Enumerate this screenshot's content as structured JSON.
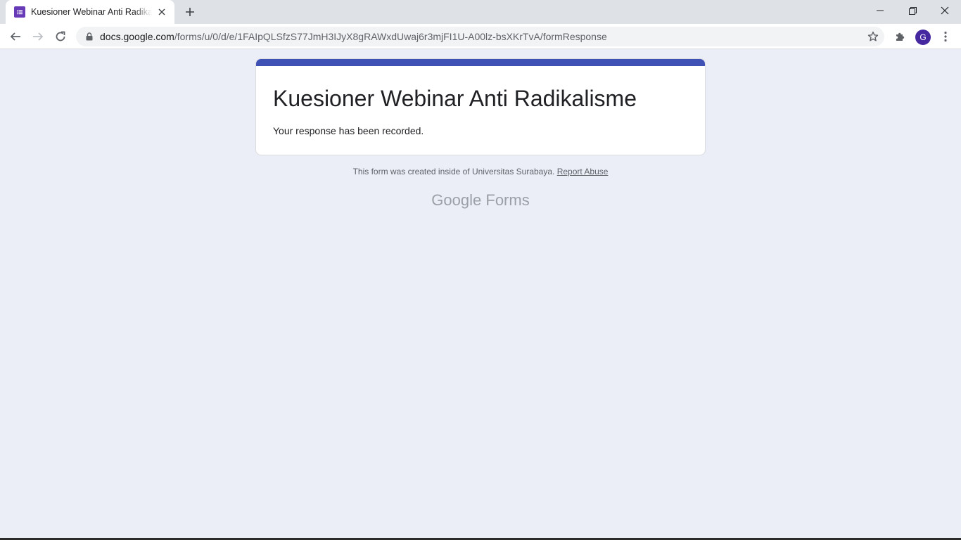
{
  "browser": {
    "tab": {
      "title": "Kuesioner Webinar Anti Radikalisme"
    },
    "address_bar": {
      "host": "docs.google.com",
      "path": "/forms/u/0/d/e/1FAIpQLSfzS77JmH3IJyX8gRAWxdUwaj6r3mjFI1U-A00lz-bsXKrTvA/formResponse"
    },
    "profile_initial": "G"
  },
  "form": {
    "title": "Kuesioner Webinar Anti Radikalisme",
    "confirmation": "Your response has been recorded.",
    "accent_color": "#3f51b5"
  },
  "footer": {
    "note": "This form was created inside of Universitas Surabaya.",
    "report_link": "Report Abuse",
    "brand_google": "Google",
    "brand_forms": "Forms"
  }
}
